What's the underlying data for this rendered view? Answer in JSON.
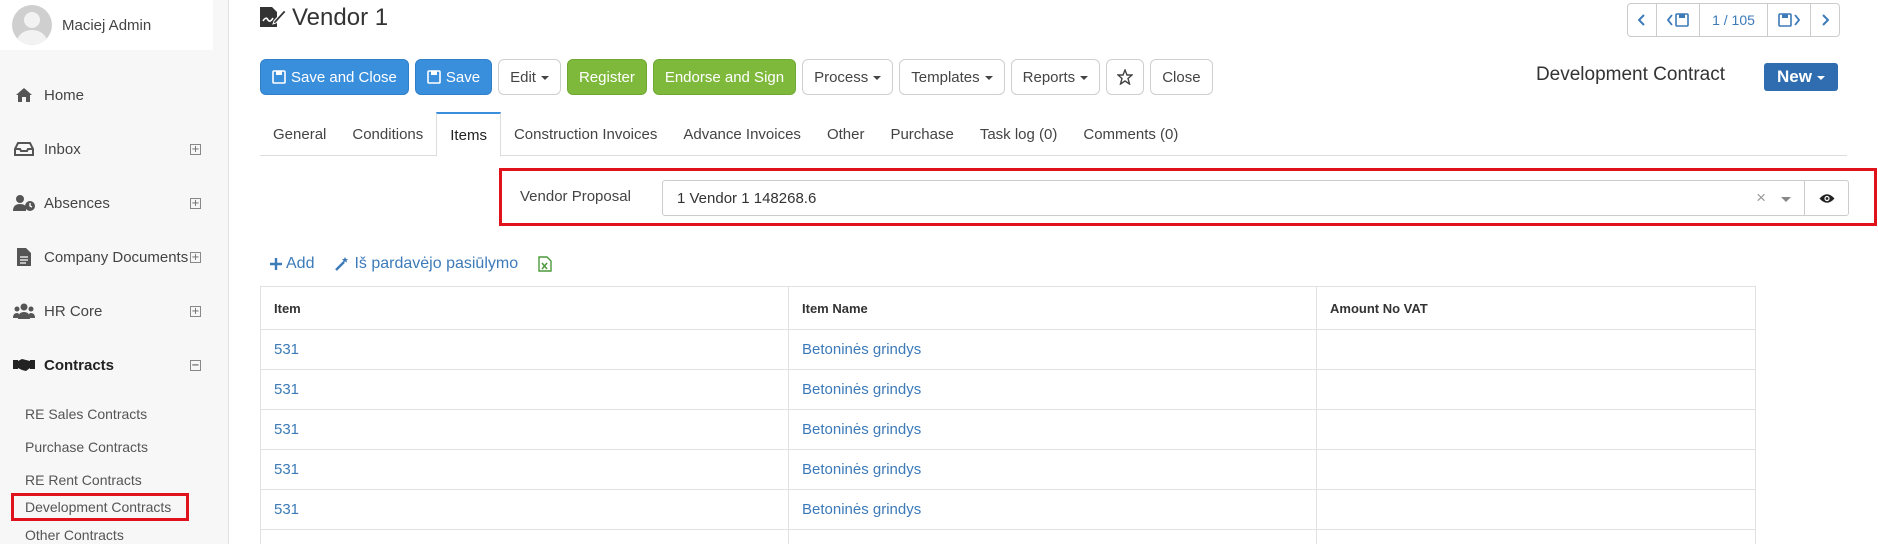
{
  "user": {
    "name": "Maciej Admin"
  },
  "sidebar": {
    "items": [
      {
        "label": "Home",
        "icon": "home-icon",
        "expandable": false
      },
      {
        "label": "Inbox",
        "icon": "inbox-icon",
        "expandable": true
      },
      {
        "label": "Absences",
        "icon": "user-clock-icon",
        "expandable": true
      },
      {
        "label": "Company Documents",
        "icon": "file-icon",
        "expandable": true
      },
      {
        "label": "HR Core",
        "icon": "users-icon",
        "expandable": true
      },
      {
        "label": "Contracts",
        "icon": "handshake-icon",
        "expandable": true,
        "expanded": true
      }
    ],
    "sub_items": [
      {
        "label": "RE Sales Contracts"
      },
      {
        "label": "Purchase Contracts"
      },
      {
        "label": "RE Rent Contracts"
      },
      {
        "label": "Development Contracts",
        "highlighted": true
      },
      {
        "label": "Other Contracts"
      }
    ],
    "expand_symbol": "+",
    "collapse_symbol": "−"
  },
  "header": {
    "title": "Vendor 1",
    "pager": {
      "position": "1 / 105"
    },
    "doc_type": "Development Contract",
    "new_label": "New"
  },
  "toolbar": {
    "save_close": "Save and Close",
    "save": "Save",
    "edit": "Edit",
    "register": "Register",
    "endorse": "Endorse and Sign",
    "process": "Process",
    "templates": "Templates",
    "reports": "Reports",
    "close": "Close"
  },
  "tabs": [
    {
      "label": "General"
    },
    {
      "label": "Conditions"
    },
    {
      "label": "Items",
      "active": true
    },
    {
      "label": "Construction Invoices"
    },
    {
      "label": "Advance Invoices"
    },
    {
      "label": "Other"
    },
    {
      "label": "Purchase"
    },
    {
      "label": "Task log (0)"
    },
    {
      "label": "Comments (0)"
    }
  ],
  "proposal": {
    "label": "Vendor Proposal",
    "value": "1 Vendor 1 148268.6",
    "clear_symbol": "×"
  },
  "actions": {
    "add": "Add",
    "from_proposal": "Iš pardavėjo pasiūlymo"
  },
  "table": {
    "headers": [
      "Item",
      "Item Name",
      "Amount No VAT"
    ],
    "rows": [
      [
        "531",
        "Betoninės grindys",
        ""
      ],
      [
        "531",
        "Betoninės grindys",
        ""
      ],
      [
        "531",
        "Betoninės grindys",
        ""
      ],
      [
        "531",
        "Betoninės grindys",
        ""
      ],
      [
        "531",
        "Betoninės grindys",
        ""
      ]
    ]
  },
  "colors": {
    "accent": "#3a8fdc",
    "success": "#7fb93c",
    "link": "#3c7ab8",
    "highlight": "#e0121b",
    "primary_dark": "#2f6db0"
  }
}
